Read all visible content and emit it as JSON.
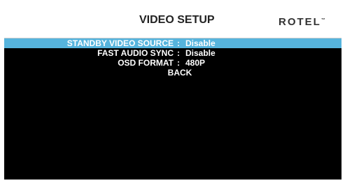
{
  "header": {
    "title": "VIDEO SETUP",
    "brand": "ROTEL"
  },
  "menu": {
    "items": [
      {
        "label": "STANDBY VIDEO SOURCE",
        "separator": ":",
        "value": "Disable",
        "selected": true
      },
      {
        "label": "FAST AUDIO SYNC",
        "separator": ":",
        "value": "Disable",
        "selected": false
      },
      {
        "label": "OSD FORMAT",
        "separator": ":",
        "value": "480P",
        "selected": false
      }
    ],
    "back_label": "BACK"
  },
  "colors": {
    "highlight": "#56b4dd",
    "screen_bg": "#000000",
    "header_bg": "#ffffff"
  }
}
